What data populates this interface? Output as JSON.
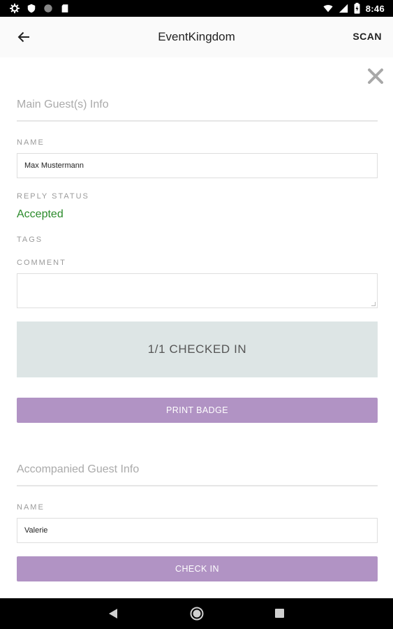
{
  "status_bar": {
    "time": "8:46",
    "left_icons": [
      "settings-icon",
      "shield-icon",
      "circle-icon",
      "sim-card-icon"
    ],
    "right_icons": [
      "wifi-icon",
      "signal-icon",
      "battery-icon"
    ]
  },
  "app_bar": {
    "title": "EventKingdom",
    "action_label": "SCAN"
  },
  "main_guest": {
    "section_title": "Main Guest(s) Info",
    "name_label": "NAME",
    "name_value": "Max Mustermann",
    "reply_status_label": "REPLY STATUS",
    "reply_status_value": "Accepted",
    "tags_label": "TAGS",
    "comment_label": "COMMENT",
    "comment_value": "",
    "checked_in_text": "1/1 CHECKED IN",
    "print_badge_label": "PRINT BADGE"
  },
  "accompanied_guest": {
    "section_title": "Accompanied Guest Info",
    "name_label": "NAME",
    "name_value": "Valerie",
    "check_in_label": "CHECK IN"
  },
  "colors": {
    "accent_purple": "#b193c4",
    "status_accepted": "#2a8a2a",
    "checked_panel_bg": "#dde5e5"
  }
}
